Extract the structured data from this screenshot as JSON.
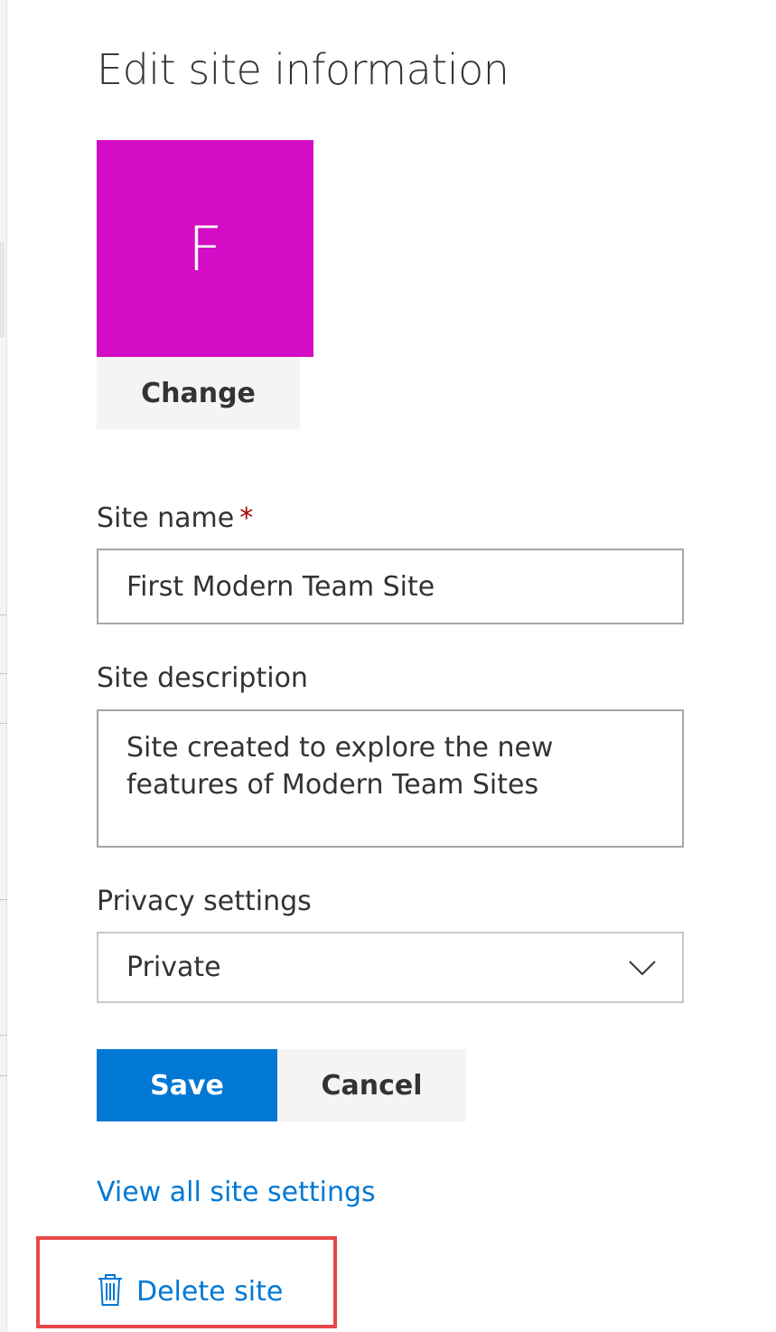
{
  "panel": {
    "title": "Edit site information",
    "logo_letter": "F",
    "logo_color": "#d40cc5",
    "change_label": "Change"
  },
  "fields": {
    "site_name_label": "Site name",
    "required_marker": "*",
    "site_name_value": "First Modern Team Site",
    "site_description_label": "Site description",
    "site_description_value": "Site created to explore the new features of Modern Team Sites",
    "privacy_label": "Privacy settings",
    "privacy_value": "Private"
  },
  "actions": {
    "save_label": "Save",
    "cancel_label": "Cancel",
    "view_all_label": "View all site settings",
    "delete_label": "Delete site"
  },
  "colors": {
    "accent": "#0078d4",
    "required": "#a80000",
    "highlight": "#e8484a",
    "neutral_button": "#f4f4f4"
  },
  "icons": {
    "privacy_dropdown": "chevron-down-icon",
    "delete": "trash-icon"
  }
}
